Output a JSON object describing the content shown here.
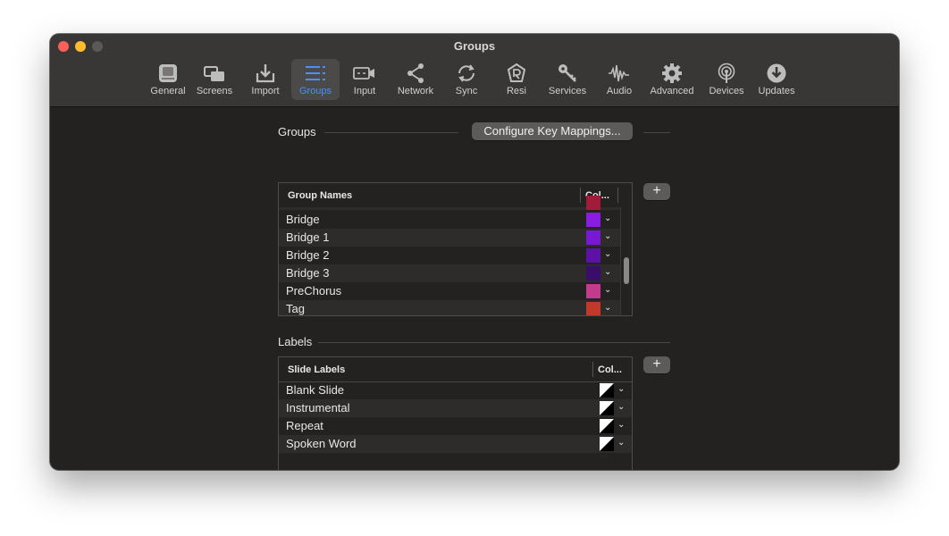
{
  "window": {
    "title": "Groups"
  },
  "toolbar": {
    "items": [
      {
        "label": "General",
        "icon": "general-icon"
      },
      {
        "label": "Screens",
        "icon": "screens-icon"
      },
      {
        "label": "Import",
        "icon": "import-icon"
      },
      {
        "label": "Groups",
        "icon": "groups-icon",
        "active": true
      },
      {
        "label": "Input",
        "icon": "input-icon"
      },
      {
        "label": "Network",
        "icon": "network-icon"
      },
      {
        "label": "Sync",
        "icon": "sync-icon"
      },
      {
        "label": "Resi",
        "icon": "resi-icon"
      },
      {
        "label": "Services",
        "icon": "services-icon"
      },
      {
        "label": "Audio",
        "icon": "audio-icon"
      },
      {
        "label": "Advanced",
        "icon": "advanced-icon"
      },
      {
        "label": "Devices",
        "icon": "devices-icon"
      },
      {
        "label": "Updates",
        "icon": "updates-icon"
      }
    ]
  },
  "groups": {
    "title": "Groups",
    "configure_label": "Configure Key Mappings...",
    "add_label": "+",
    "columns": [
      "Group Names",
      "Col..."
    ],
    "rows": [
      {
        "name": "Bridge",
        "color": "#8a1be0"
      },
      {
        "name": "Bridge 1",
        "color": "#7a17d4"
      },
      {
        "name": "Bridge 2",
        "color": "#5d12a6"
      },
      {
        "name": "Bridge 3",
        "color": "#3a0c6b"
      },
      {
        "name": "PreChorus",
        "color": "#c23b8c"
      },
      {
        "name": "Tag",
        "color": "#c0392b"
      }
    ]
  },
  "labels": {
    "title": "Labels",
    "add_label": "+",
    "columns": [
      "Slide Labels",
      "Col..."
    ],
    "rows": [
      {
        "name": "Blank Slide"
      },
      {
        "name": "Instrumental"
      },
      {
        "name": "Repeat"
      },
      {
        "name": "Spoken Word"
      }
    ]
  }
}
